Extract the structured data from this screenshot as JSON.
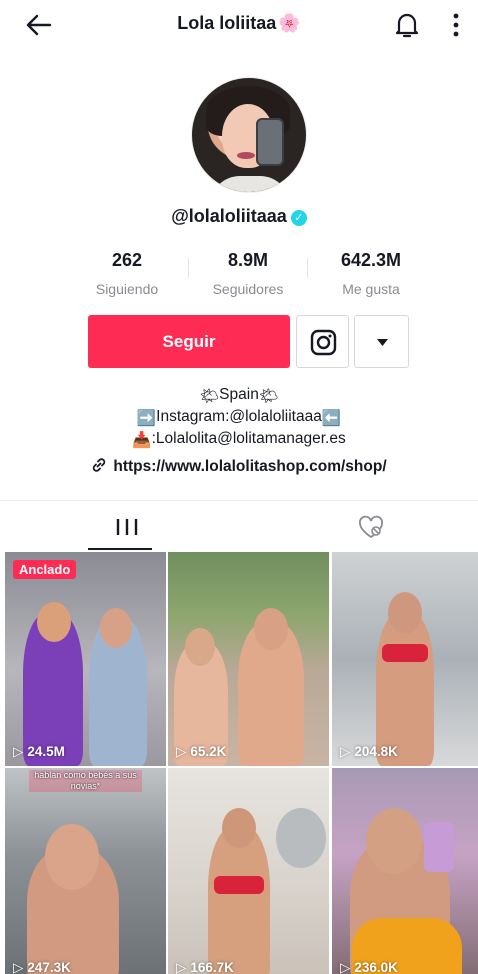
{
  "header": {
    "title": "Lola loliitaa",
    "title_emoji": "🌸"
  },
  "profile": {
    "username": "@lolaloliitaaa",
    "verified_mark": "✓",
    "stats": [
      {
        "value": "262",
        "label": "Siguiendo"
      },
      {
        "value": "8.9M",
        "label": "Seguidores"
      },
      {
        "value": "642.3M",
        "label": "Me gusta"
      }
    ],
    "follow_label": "Seguir",
    "bio": {
      "line1_emoji": "🌤",
      "line1_text": "Spain",
      "line2_arrow_left": "➡️",
      "line2_text": "Instagram:@lolaloliitaaa",
      "line2_arrow_right": "⬅️",
      "line3_emoji": "📥",
      "line3_text": ":Lolalolita@lolitamanager.es"
    },
    "link": "https://www.lolalolitashop.com/shop/"
  },
  "tabs": {
    "videos_icon": "grid-icon",
    "liked_icon": "hidden-heart-icon"
  },
  "videos": [
    {
      "views": "24.5M",
      "pinned_label": "Anclado"
    },
    {
      "views": "65.2K"
    },
    {
      "views": "204.8K"
    },
    {
      "views": "247.3K",
      "caption": "hablan como bebés a sus novias*"
    },
    {
      "views": "166.7K"
    },
    {
      "views": "236.0K"
    }
  ],
  "colors": {
    "accent": "#fe2c55",
    "verified": "#20d5ec",
    "text": "#161823",
    "muted": "#8a8b91"
  }
}
